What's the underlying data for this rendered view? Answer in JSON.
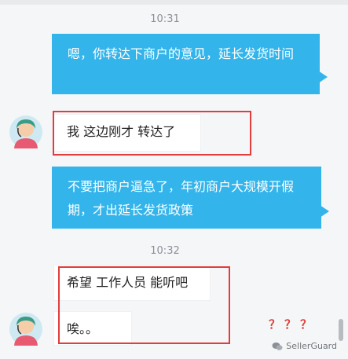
{
  "messages": [
    {
      "type": "time",
      "text": "10:31"
    },
    {
      "type": "outgoing",
      "text": "嗯，你转达下商户的意见，延长发货时间"
    },
    {
      "type": "incoming",
      "text": "我 这边刚才 转达了"
    },
    {
      "type": "outgoing",
      "text": "不要把商户逼急了，年初商户大规模开假期，才出延长发货政策"
    },
    {
      "type": "time",
      "text": "10:32"
    },
    {
      "type": "incoming",
      "text": "希望 工作人员 能听吧"
    },
    {
      "type": "incoming",
      "text": "唉。。"
    }
  ],
  "annotation": {
    "text": "？？？",
    "color": "#e23c3c"
  },
  "watermark": {
    "text": "SellerGuard",
    "icon": "wechat-icon"
  },
  "colors": {
    "outgoing_bubble": "#33b4ea",
    "highlight_box": "#e23c3c",
    "background": "#f5f6f7"
  }
}
